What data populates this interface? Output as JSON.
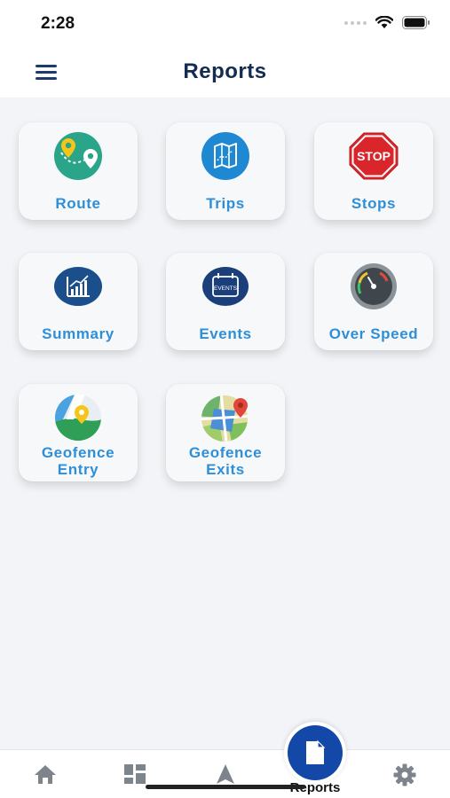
{
  "status_bar": {
    "time": "2:28"
  },
  "header": {
    "title": "Reports"
  },
  "tiles": [
    {
      "label": "Route",
      "icon": "route-pin-icon"
    },
    {
      "label": "Trips",
      "icon": "map-icon"
    },
    {
      "label": "Stops",
      "icon": "stop-sign-icon"
    },
    {
      "label": "Summary",
      "icon": "bar-chart-icon"
    },
    {
      "label": "Events",
      "icon": "events-calendar-icon"
    },
    {
      "label": "Over Speed",
      "icon": "speedometer-icon"
    },
    {
      "label_line1": "Geofence",
      "label_line2": "Entry",
      "icon": "geofence-entry-map-icon"
    },
    {
      "label_line1": "Geofence",
      "label_line2": "Exits",
      "icon": "geofence-exit-map-icon"
    }
  ],
  "stop_sign_text": "STOP",
  "events_badge_text": "EVENTS",
  "bottom_nav": {
    "items": [
      "home",
      "dashboard",
      "navigation",
      "reports",
      "settings"
    ],
    "active_label": "Reports"
  },
  "colors": {
    "accent": "#2e8fd9",
    "title": "#142c4f",
    "nav_active": "#1448a8",
    "background": "#f2f4f7"
  }
}
